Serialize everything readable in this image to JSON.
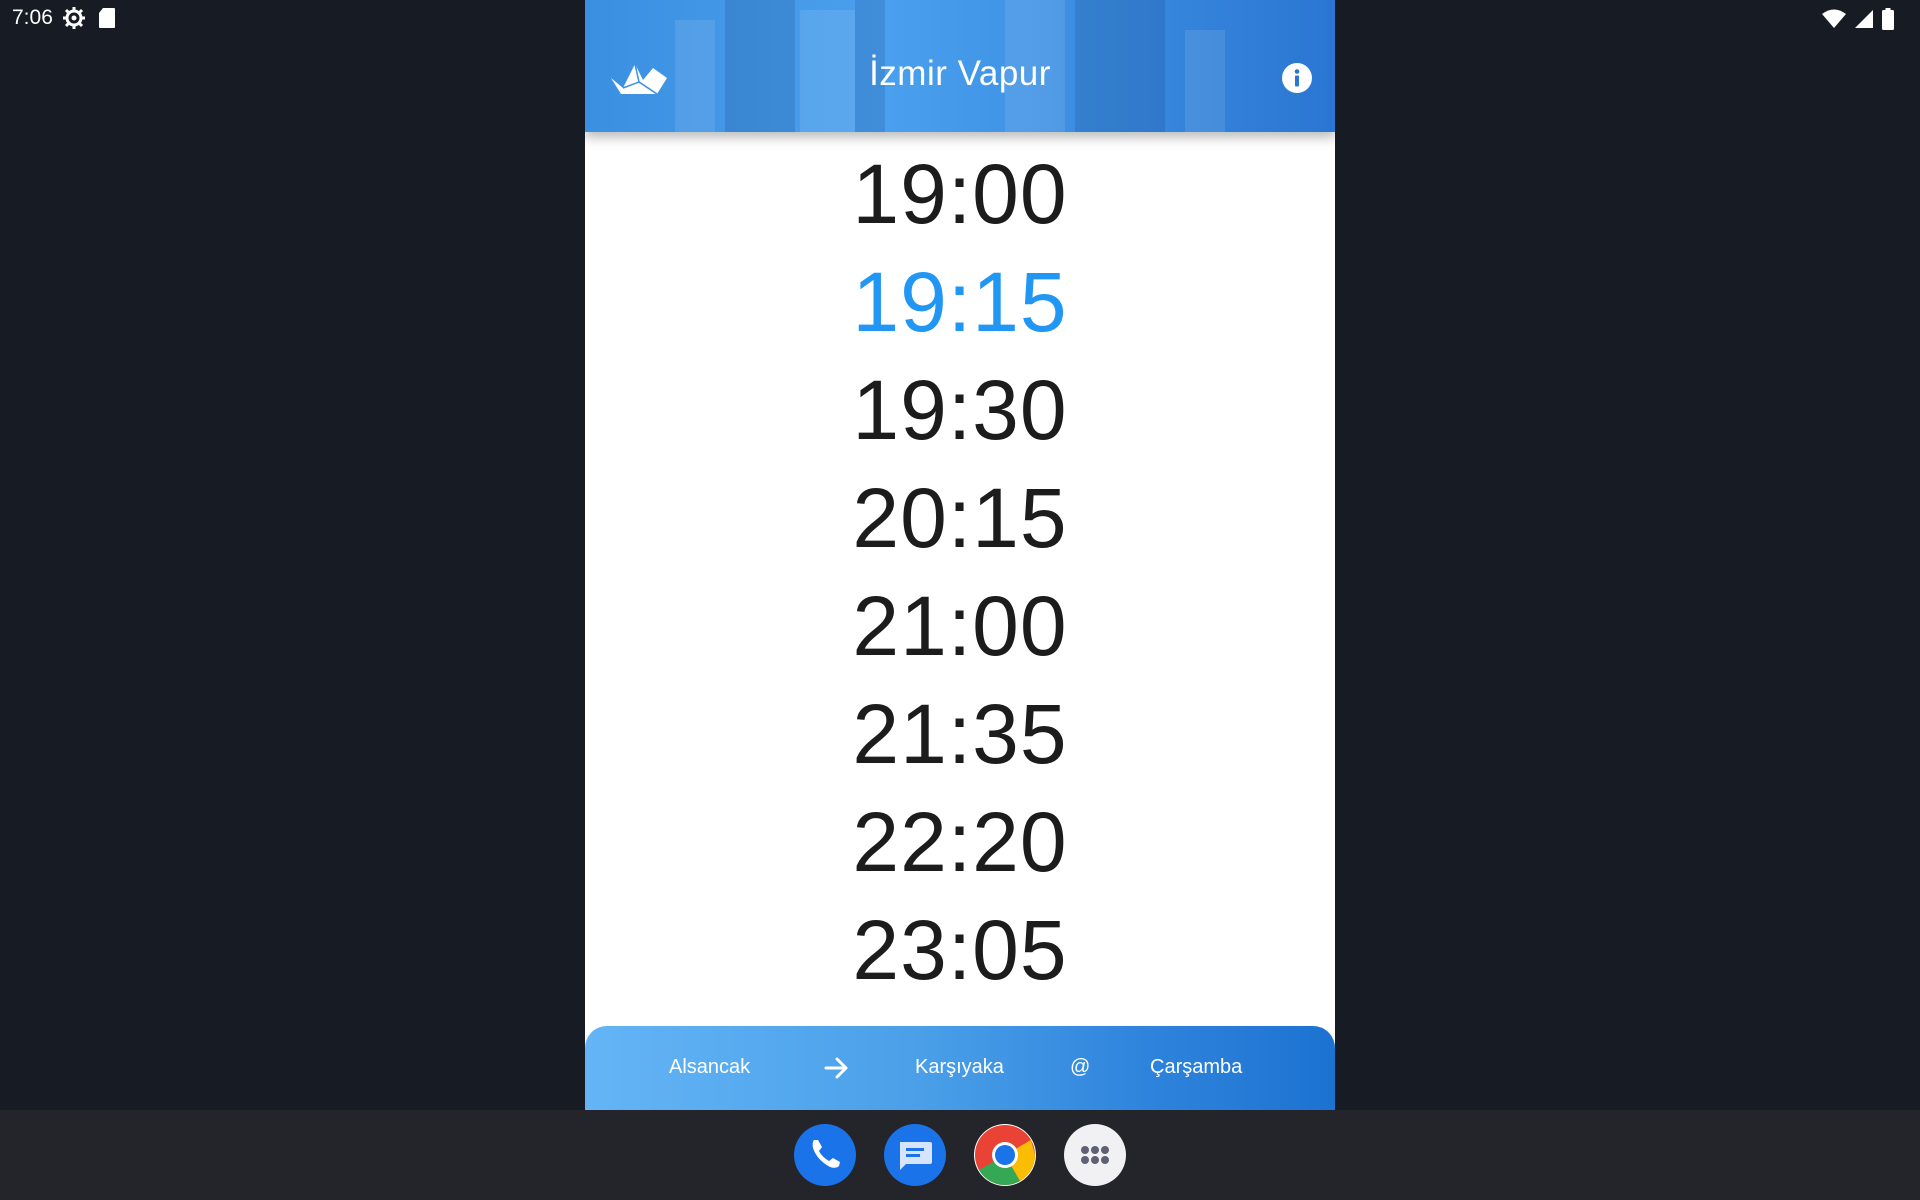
{
  "status_bar": {
    "time": "7:06",
    "left_icons": [
      "settings-gear-icon",
      "sd-card-icon"
    ],
    "right_icons": [
      "wifi-icon",
      "cell-signal-icon",
      "battery-icon"
    ]
  },
  "app": {
    "title": "İzmir Vapur",
    "logo_icon": "paper-boat-icon",
    "info_icon": "info-icon",
    "accent_color": "#2196f3",
    "departures": [
      "19:00",
      "19:15",
      "19:30",
      "20:15",
      "21:00",
      "21:35",
      "22:20",
      "23:05"
    ],
    "highlighted_departure": "19:15",
    "route": {
      "from": "Alsancak",
      "arrow_icon": "arrow-right-icon",
      "to": "Karşıyaka",
      "separator": "@",
      "day": "Çarşamba"
    }
  },
  "dock": {
    "apps": [
      "phone-icon",
      "messages-icon",
      "chrome-icon",
      "app-drawer-icon"
    ]
  }
}
